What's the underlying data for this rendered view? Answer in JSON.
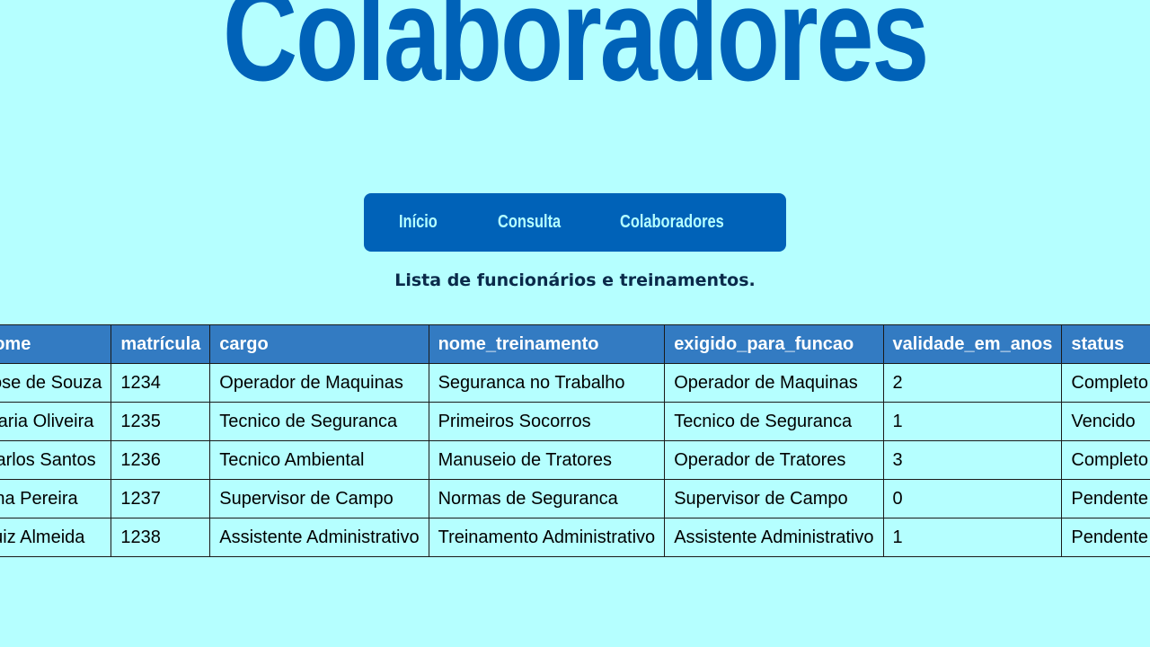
{
  "header": {
    "title": "Colaboradores"
  },
  "nav": {
    "items": [
      {
        "label": "Início"
      },
      {
        "label": "Consulta"
      },
      {
        "label": "Colaboradores"
      }
    ]
  },
  "subtitle": "Lista de funcionários e treinamentos.",
  "table": {
    "columns": [
      "nome",
      "matrícula",
      "cargo",
      "nome_treinamento",
      "exigido_para_funcao",
      "validade_em_anos",
      "status"
    ],
    "rows": [
      [
        "Jose de Souza",
        "1234",
        "Operador de Maquinas",
        "Seguranca no Trabalho",
        "Operador de Maquinas",
        "2",
        "Completo"
      ],
      [
        "Maria Oliveira",
        "1235",
        "Tecnico de Seguranca",
        "Primeiros Socorros",
        "Tecnico de Seguranca",
        "1",
        "Vencido"
      ],
      [
        "Carlos Santos",
        "1236",
        "Tecnico Ambiental",
        "Manuseio de Tratores",
        "Operador de Tratores",
        "3",
        "Completo"
      ],
      [
        "Ana Pereira",
        "1237",
        "Supervisor de Campo",
        "Normas de Seguranca",
        "Supervisor de Campo",
        "0",
        "Pendente"
      ],
      [
        "Luiz Almeida",
        "1238",
        "Assistente Administrativo",
        "Treinamento Administrativo",
        "Assistente Administrativo",
        "1",
        "Pendente"
      ]
    ]
  },
  "colors": {
    "background": "#b5ffff",
    "brand": "#0062b8",
    "table_header": "#337bc2"
  }
}
